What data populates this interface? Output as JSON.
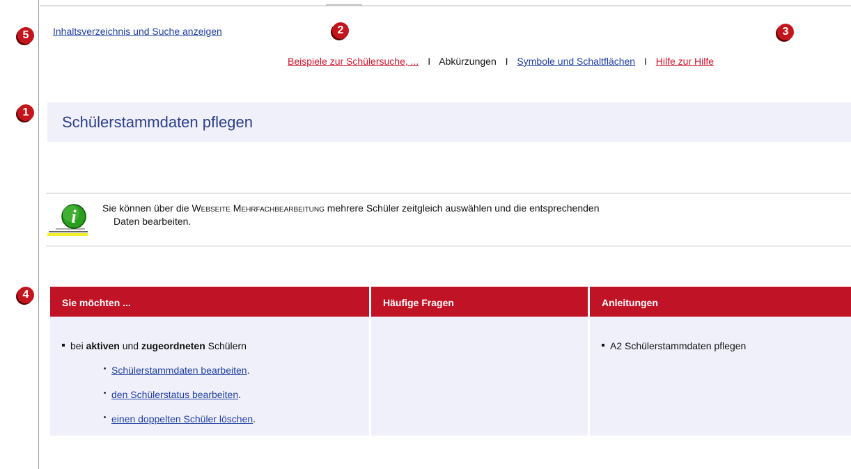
{
  "toc_link": "Inhaltsverzeichnis und Suche anzeigen",
  "badges": [
    "5",
    "2",
    "3",
    "1",
    "4"
  ],
  "help_nav": {
    "examples": "Beispiele zur Schülersuche, ...",
    "separator": "I",
    "abbreviations": "Abkürzungen",
    "symbols": "Symbole und Schaltflächen",
    "help": "Hilfe zur Hilfe"
  },
  "page_title": "Schülerstammdaten pflegen",
  "info": {
    "pre": "Sie können über die ",
    "website": "Webseite Mehrfachbearbeitung",
    "post": " mehrere Schüler zeitgleich auswählen und die entsprechenden",
    "line2": "Daten bearbeiten."
  },
  "table": {
    "headers": [
      "Sie möchten ...",
      "Häufige Fragen",
      "Anleitungen"
    ],
    "intro": {
      "pre": "bei ",
      "b1": "aktiven",
      "mid": " und ",
      "b2": "zugeordneten",
      "post": " Schülern"
    },
    "links": [
      "Schülerstammdaten bearbeiten",
      "den Schülerstatus bearbeiten",
      "einen doppelten Schüler löschen"
    ],
    "period": ".",
    "guides": [
      "A2 Schülerstammdaten pflegen"
    ]
  },
  "colors": {
    "accent_red": "#c01326",
    "link_blue": "#1f3fa0",
    "title_blue": "#2a3f86",
    "panel_bg": "#f0f0fa"
  }
}
